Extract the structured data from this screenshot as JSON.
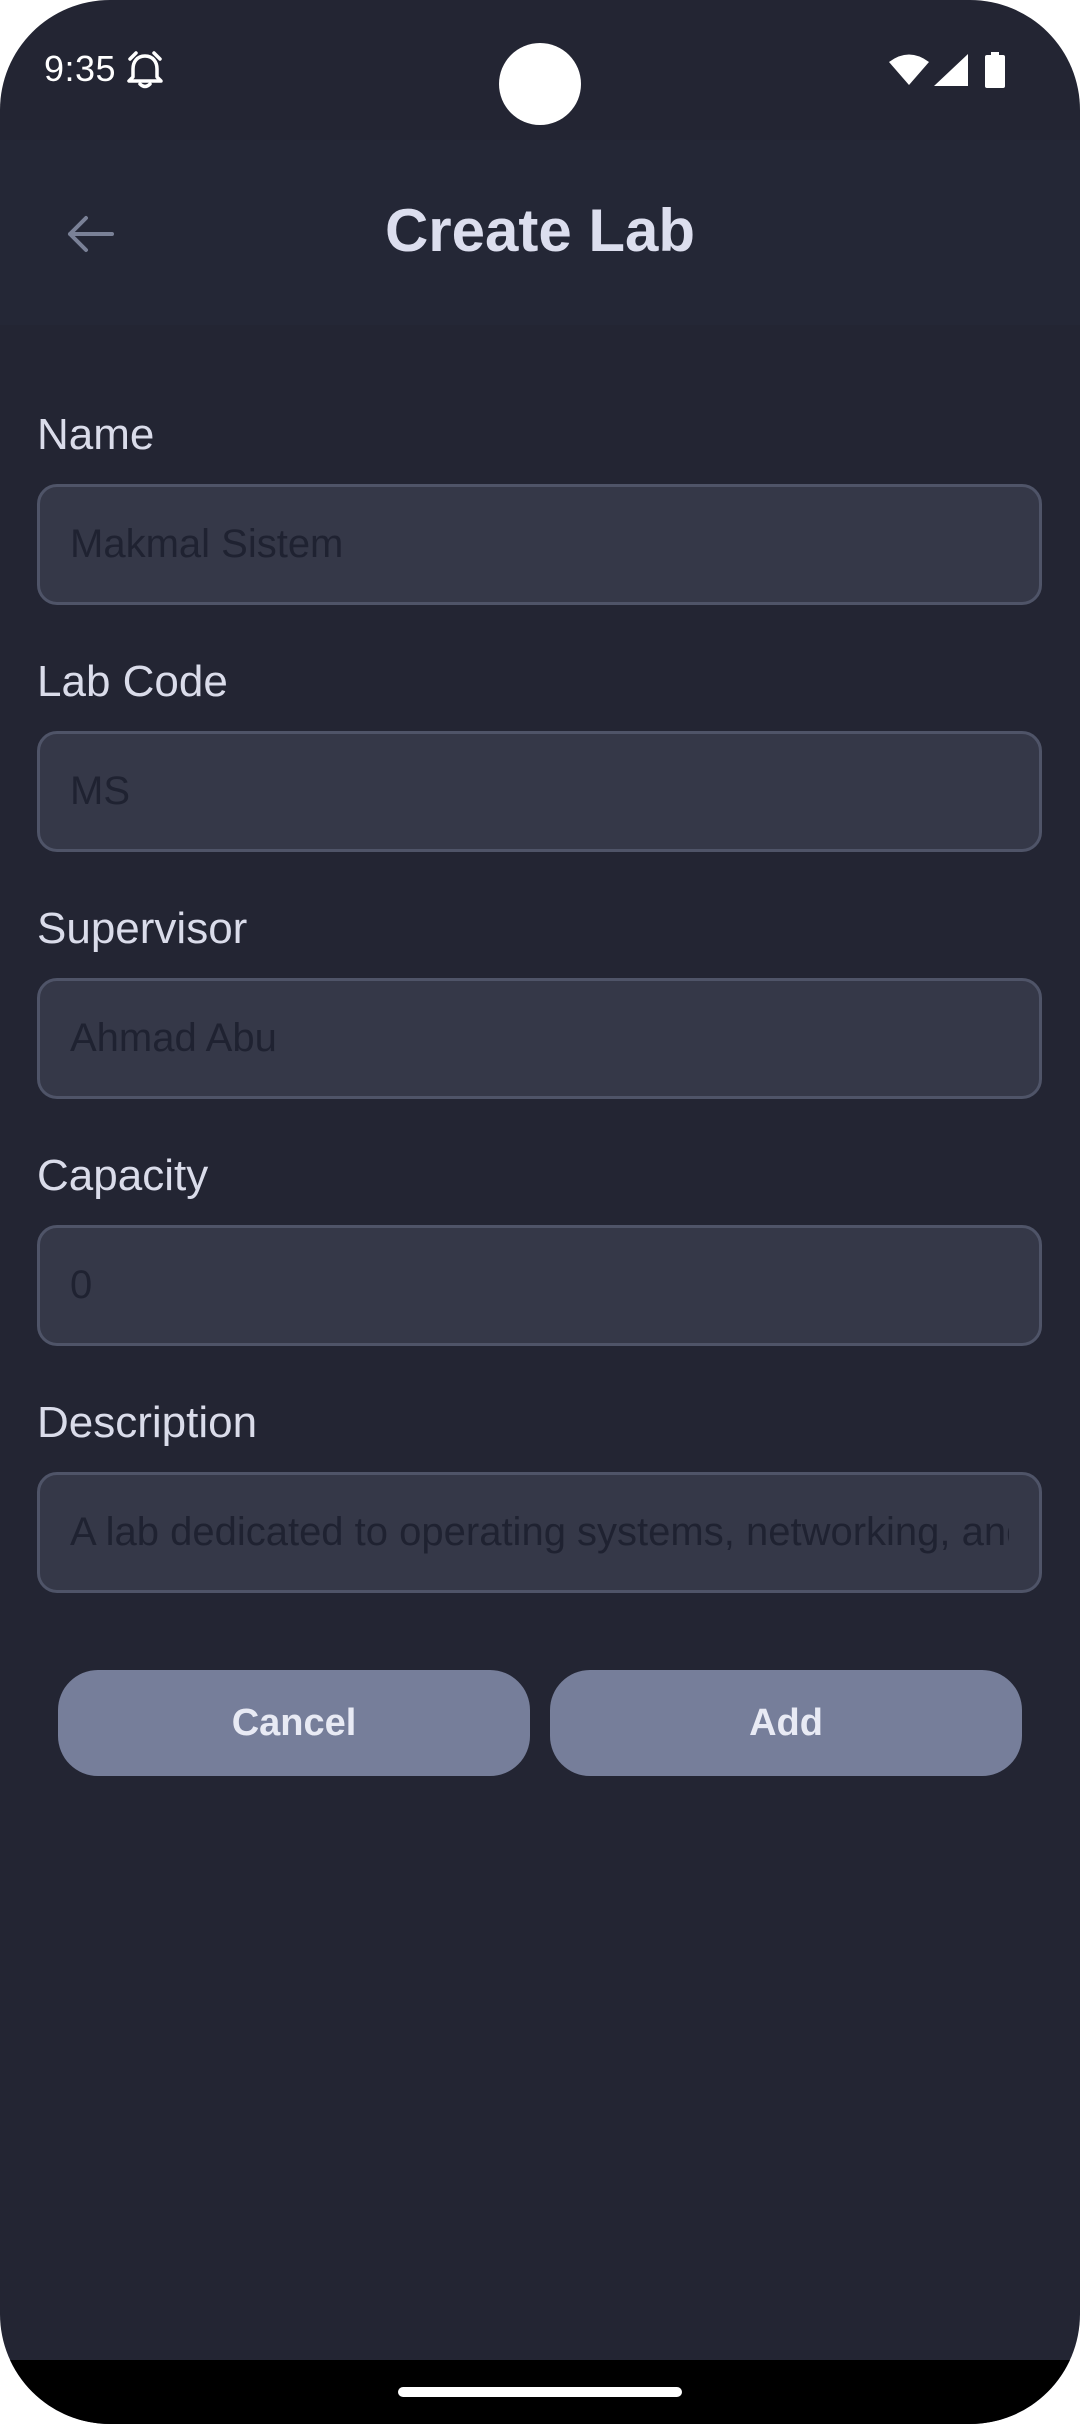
{
  "status_bar": {
    "time": "9:35",
    "icons": [
      "alarm-icon",
      "wifi-icon",
      "signal-icon",
      "battery-icon"
    ]
  },
  "app_bar": {
    "back_icon": "arrow-left-icon",
    "title": "Create Lab"
  },
  "form": {
    "name": {
      "label": "Name",
      "value": "",
      "placeholder": "Makmal Sistem"
    },
    "lab_code": {
      "label": "Lab Code",
      "value": "",
      "placeholder": "MS"
    },
    "supervisor": {
      "label": "Supervisor",
      "value": "",
      "placeholder": "Ahmad Abu"
    },
    "capacity": {
      "label": "Capacity",
      "value": "",
      "placeholder": "0"
    },
    "description": {
      "label": "Description",
      "value": "",
      "placeholder": "A lab dedicated to operating systems, networking, and"
    }
  },
  "actions": {
    "cancel_label": "Cancel",
    "add_label": "Add"
  },
  "colors": {
    "background": "#232533",
    "input_fill": "#353848",
    "input_border": "#4f5468",
    "button": "#767e9a"
  }
}
